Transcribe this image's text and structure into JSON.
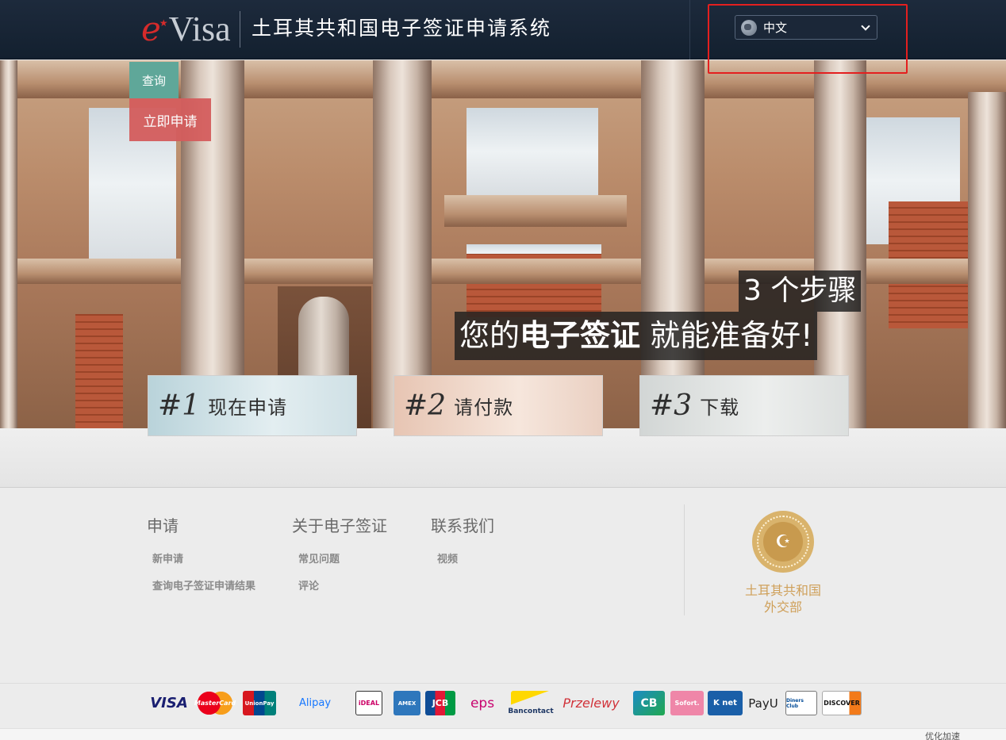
{
  "header": {
    "logo_e": "e",
    "logo_visa": "Visa",
    "title": "土耳其共和国电子签证申请系统",
    "language": {
      "selected": "中文"
    }
  },
  "hero": {
    "query_label": "查询",
    "apply_label": "立即申请",
    "headline_line1": "3 个步骤",
    "headline_line2_a": "您的",
    "headline_line2_b": "电子签证",
    "headline_line2_c": " 就能准备好!",
    "steps": [
      {
        "num": "#1",
        "label": "现在申请"
      },
      {
        "num": "#2",
        "label": "请付款"
      },
      {
        "num": "#3",
        "label": "下载"
      }
    ]
  },
  "footer": {
    "columns": [
      {
        "title": "申请",
        "links": [
          "新申请",
          "查询电子签证申请结果"
        ]
      },
      {
        "title": "关于电子签证",
        "links": [
          "常见问题",
          "评论"
        ]
      },
      {
        "title": "联系我们",
        "links": [
          "视频"
        ]
      }
    ],
    "ministry_line1": "土耳其共和国",
    "ministry_line2": "外交部"
  },
  "payments": [
    "VISA",
    "MasterCard",
    "UnionPay",
    "Alipay",
    "iDEAL",
    "AMEX",
    "JCB",
    "eps",
    "Bancontact",
    "Przelewy",
    "CB",
    "Sofort.",
    "K net",
    "PayU",
    "Diners Club",
    "DISCOVER"
  ],
  "status": {
    "text": "优化加速"
  },
  "colors": {
    "header_bg": "#16222f",
    "query_btn": "#5fa799",
    "apply_btn": "#d45d5d",
    "highlight": "#e41f1f",
    "ministry_gold": "#cfa05a"
  }
}
